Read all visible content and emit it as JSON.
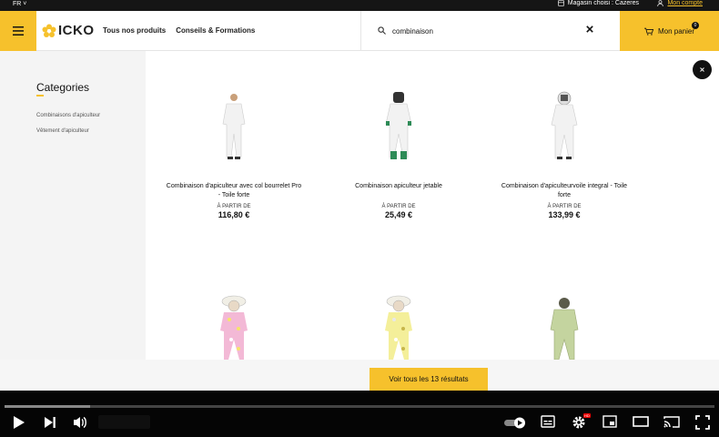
{
  "topbar": {
    "language": "FR",
    "store_label": "Magasin choisi : Cazeres",
    "account_label": "Mon compte"
  },
  "header": {
    "logo_text": "ICKO",
    "nav": [
      "Tous nos produits",
      "Conseils & Formations"
    ],
    "search_value": "combinaison",
    "cart_label": "Mon panier",
    "cart_count": "0"
  },
  "sidebar": {
    "title": "Categories",
    "items": [
      "Combinaisons d'apiculteur",
      "Vêtement d'apiculteur"
    ]
  },
  "products": [
    {
      "name": "Combinaison d'apiculteur avec col bourrelet Pro - Toile forte",
      "from": "À PARTIR DE",
      "price": "116,80 €"
    },
    {
      "name": "Combinaison apiculteur jetable",
      "from": "À PARTIR DE",
      "price": "25,49 €"
    },
    {
      "name": "Combinaison d'apiculteurvoile integral - Toile forte",
      "from": "À PARTIR DE",
      "price": "133,99 €"
    }
  ],
  "see_all_label": "Voir tous les 13 résultats",
  "player": {
    "progress_fraction": 0.12
  },
  "colors": {
    "accent": "#f6c12c",
    "dark": "#111111"
  }
}
